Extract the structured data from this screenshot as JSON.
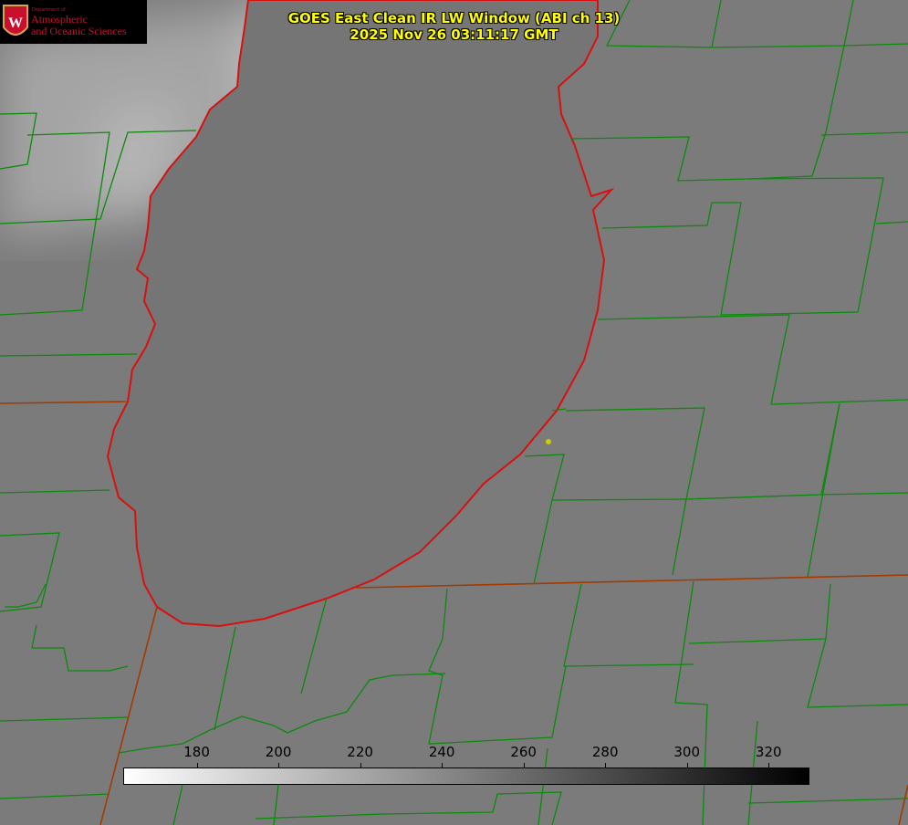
{
  "title": {
    "line1": "GOES East Clean IR LW Window (ABI ch 13)",
    "line2": "2025 Nov 26 03:11:17 GMT"
  },
  "logo": {
    "dept": "Department of",
    "name1": "Atmospheric",
    "name2": "and Oceanic Sciences",
    "emblem": "W"
  },
  "colorbar": {
    "ticks": [
      "180",
      "200",
      "220",
      "240",
      "260",
      "280",
      "300",
      "320"
    ],
    "tick_values": [
      180,
      200,
      220,
      240,
      260,
      280,
      300,
      320
    ],
    "range": [
      162,
      330
    ],
    "colormap": "white-to-black grayscale"
  },
  "colors": {
    "title": "#ffff00",
    "coastline": "#ff0000",
    "county_lines": "#008000",
    "state_lines": "#cc3300",
    "marker": "#cccc00"
  }
}
